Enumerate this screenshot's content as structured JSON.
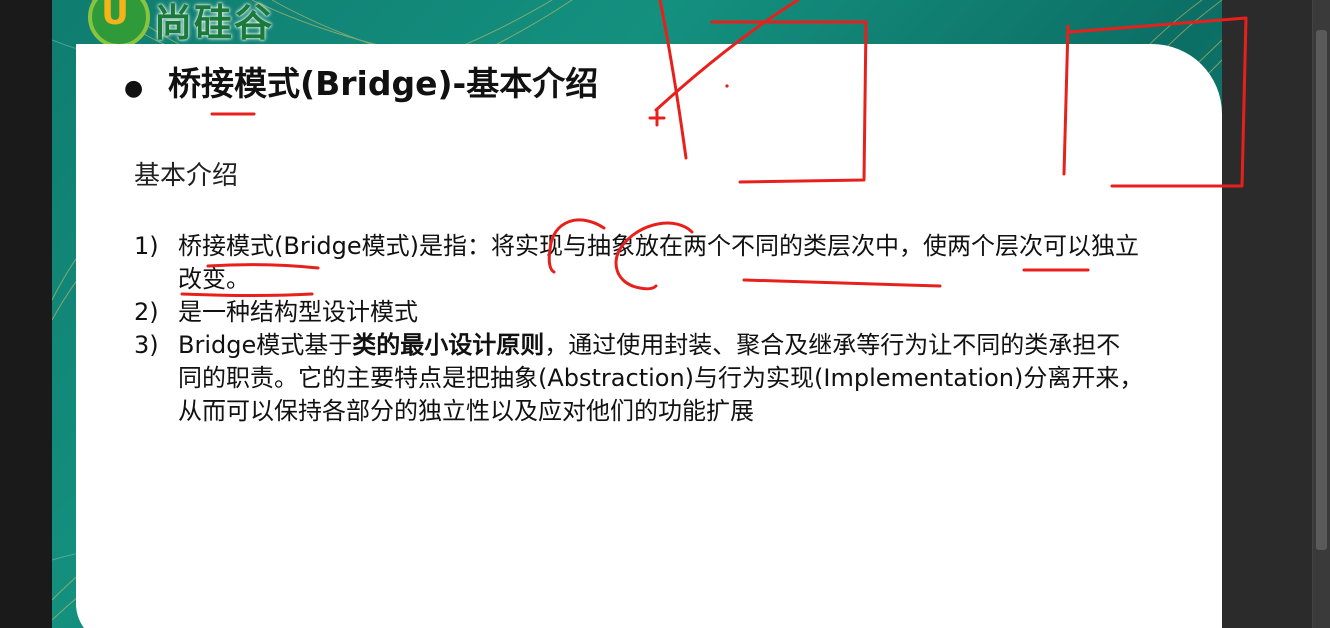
{
  "logo": {
    "text": "尚硅谷",
    "mark": "U"
  },
  "slide": {
    "title": "桥接模式(Bridge)-基本介绍",
    "intro": "基本介绍",
    "items": [
      {
        "num": "1)",
        "text": "桥接模式(Bridge模式)是指：将实现与抽象放在两个不同的类层次中，使两个层次可以独立改变。"
      },
      {
        "num": "2)",
        "text": "是一种结构型设计模式"
      },
      {
        "num": "3)",
        "pre": "Bridge模式基于",
        "bold": "类的最小设计原则",
        "post": "，通过使用封装、聚合及继承等行为让不同的类承担不同的职责。它的主要特点是把抽象(Abstraction)与行为实现(Implementation)分离开来，从而可以保持各部分的独立性以及应对他们的功能扩展"
      }
    ]
  },
  "colors": {
    "slide_bg": "#14907f",
    "annotation": "#e8201c",
    "logo_green": "#1a7a3a",
    "logo_orange": "#f6b21a"
  }
}
